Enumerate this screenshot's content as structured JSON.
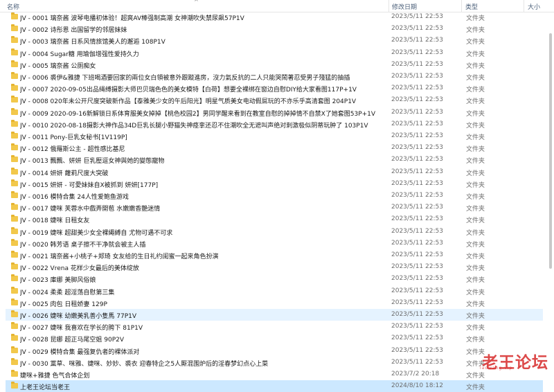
{
  "columns": {
    "name": "名称",
    "date": "修改日期",
    "type": "类型",
    "size": "大小"
  },
  "sort_indicator": "^",
  "rows": [
    {
      "name": "JV - 0001 璃奈酱 波琴电播初体验！超爽AV棒强制高潮 女神潮吹失禁尿飙57P1V",
      "date": "2023/5/11 22:53",
      "type": "文件夹"
    },
    {
      "name": "JV - 0002 诗彤恩 出国留学的邻居妹妹",
      "date": "2023/5/11 22:53",
      "type": "文件夹"
    },
    {
      "name": "JV - 0003 璃奈酱 日系风情旅馆美人的邂逅 108P1V",
      "date": "2023/5/11 22:53",
      "type": "文件夹"
    },
    {
      "name": "JV - 0004 Sugar糖 用瑜伽增强性爱持久力",
      "date": "2023/5/11 22:53",
      "type": "文件夹"
    },
    {
      "name": "JV - 0005 璃奈酱 公厕痴女",
      "date": "2023/5/11 22:53",
      "type": "文件夹"
    },
    {
      "name": "JV - 0006 裘伊&雅捷 下班喝酒要回家的兩位女白領被意外跟蹤進房，沒力氣反抗的二人只能哭鬧著忍受男子殘猛的抽插",
      "date": "2023/5/11 22:53",
      "type": "文件夹"
    },
    {
      "name": "JV - 0007 2020-09-05出品绳缚摄影大师巴贝瑞色色的美女模特【白荷】想要全裸绑在窗边自慰DIY给大家看图117P+1V",
      "date": "2023/5/11 22:53",
      "type": "文件夹"
    },
    {
      "name": "JV - 0008 020年未公开尺度突破新作品【泰雅美少女的午后阳光】明星气质美女电动假屌玩的不亦乐乎高清套图 204P1V",
      "date": "2023/5/11 22:53",
      "type": "文件夹"
    },
    {
      "name": "JV - 0009 2020-09-16新解锁日系体育服美女掉掉【桃色校园2】男同学醒来看到在教室自慰的掉掉情不自禁X了她套图53P+1V",
      "date": "2023/5/11 22:53",
      "type": "文件夹"
    },
    {
      "name": "JV - 0010 2020-08-18摄影大神作品34D巨乳长腿小野猫失神痉挛还忍不住潮吹全无遮叫声绝对刺激极似阴蒂玩肿了 103P1V",
      "date": "2023/5/11 22:53",
      "type": "文件夹"
    },
    {
      "name": "JV - 0011 Pony-巨乳女秘书[1V119P]",
      "date": "2023/5/11 22:53",
      "type": "文件夹"
    },
    {
      "name": "JV - 0012 俄羅斯公主 - 超性感比基尼",
      "date": "2023/5/11 22:53",
      "type": "文件夹"
    },
    {
      "name": "JV - 0013 飄飄、妍妍 巨乳壓逗女神與她的變態寵物",
      "date": "2023/5/11 22:53",
      "type": "文件夹"
    },
    {
      "name": "JV - 0014 妍妍 蘿莉尺度大突破",
      "date": "2023/5/11 22:53",
      "type": "文件夹"
    },
    {
      "name": "JV - 0015 妍妍 - 可愛妹妹自X被抓到 妍妍[177P]",
      "date": "2023/5/11 22:53",
      "type": "文件夹"
    },
    {
      "name": "JV - 0016 模特合集 24人性爱鲍鱼游戏",
      "date": "2023/5/11 22:53",
      "type": "文件夹"
    },
    {
      "name": "JV - 0017 婕咪 芙蓉水中戲弄開苞 水嫩嫩香艷迷情",
      "date": "2023/5/11 22:53",
      "type": "文件夹"
    },
    {
      "name": "JV - 0018 婕咪 日租女友",
      "date": "2023/5/11 22:53",
      "type": "文件夹"
    },
    {
      "name": "JV - 0019 婕咪 超甜美少女全裸繩縛自 尤物可遇不可求",
      "date": "2023/5/11 22:53",
      "type": "文件夹"
    },
    {
      "name": "JV - 0020 韩芳语 桌子擦不干净就会被主人插",
      "date": "2023/5/11 22:53",
      "type": "文件夹"
    },
    {
      "name": "JV - 0021 璃奈酱+小桃子+郑琦 女友给的生日礼约闺蜜一起来角色扮演",
      "date": "2023/5/11 22:53",
      "type": "文件夹"
    },
    {
      "name": "JV - 0022 Vrena 花样少女最后的美体绽放",
      "date": "2023/5/11 22:53",
      "type": "文件夹"
    },
    {
      "name": "JV - 0023 庫娜 美脚风俗娘",
      "date": "2023/5/11 22:53",
      "type": "文件夹"
    },
    {
      "name": "JV - 0024 柔柔 超淫荡自慰第三集",
      "date": "2023/5/11 22:53",
      "type": "文件夹"
    },
    {
      "name": "JV - 0025 肉包 日租娇妻 129P",
      "date": "2023/5/11 22:53",
      "type": "文件夹"
    },
    {
      "name": "JV - 0026 婕咪 幼嫩美乳善小隻馬 77P1V",
      "date": "2023/5/11 22:53",
      "type": "文件夹"
    },
    {
      "name": "JV - 0027 婕咪 我喜欢在学长的胯下 81P1V",
      "date": "2023/5/11 22:53",
      "type": "文件夹"
    },
    {
      "name": "JV - 0028 昆娜 超正马尾空姐 90P2V",
      "date": "2023/5/11 22:53",
      "type": "文件夹"
    },
    {
      "name": "JV - 0029 模特合集 最强复仇者的裸体派对",
      "date": "2023/5/11 22:53",
      "type": "文件夹"
    },
    {
      "name": "JV - 0030 黨草、咪雅、婕咪、妙妙、裘衣 迎春特企之5人厮混围炉后的淫春梦幻点心上菜",
      "date": "2023/5/11 22:53",
      "type": "文件夹"
    },
    {
      "name": "婕咪+雅捷 色气合体企划",
      "date": "2023/7/2 20:18",
      "type": "文件夹"
    },
    {
      "name": "上老王论坛当老王",
      "date": "2024/8/10 18:12",
      "type": "文件夹"
    }
  ],
  "watermark": {
    "text": "老王论坛",
    "url": "laowang.vip"
  }
}
